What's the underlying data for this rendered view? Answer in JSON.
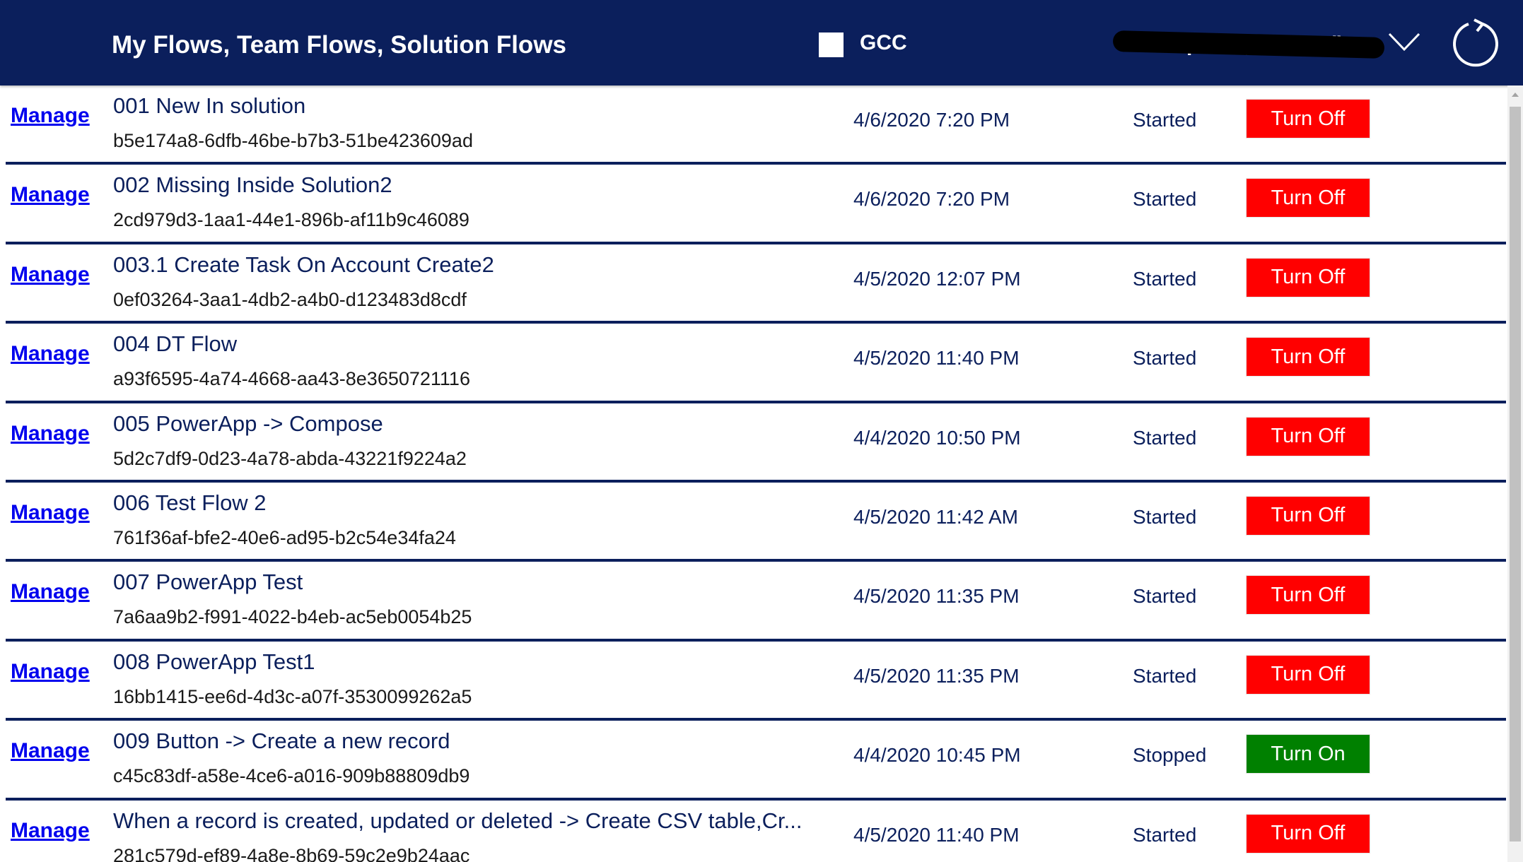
{
  "header": {
    "title": "My Flows, Team Flows, Solution Flows",
    "gcc_label": "GCC",
    "gcc_checked": false,
    "environment_label": "Lookup Inc (redacted)",
    "environment_redacted": true,
    "chevron_icon": "chevron-down-icon",
    "refresh_icon": "refresh-icon",
    "background_color": "#0b1f5c"
  },
  "colors": {
    "turn_off": "#ff0000",
    "turn_on": "#008000",
    "link": "#0000ee",
    "text": "#0b1f5c"
  },
  "flows": [
    {
      "manage_label": "Manage",
      "name": "001 New In solution",
      "id": "b5e174a8-6dfb-46be-b7b3-51be423609ad",
      "modified": "4/6/2020 7:20 PM",
      "status": "Started",
      "action_label": "Turn Off",
      "action_color": "#ff0000"
    },
    {
      "manage_label": "Manage",
      "name": "002 Missing Inside Solution2",
      "id": "2cd979d3-1aa1-44e1-896b-af11b9c46089",
      "modified": "4/6/2020 7:20 PM",
      "status": "Started",
      "action_label": "Turn Off",
      "action_color": "#ff0000"
    },
    {
      "manage_label": "Manage",
      "name": "003.1 Create Task On Account Create2",
      "id": "0ef03264-3aa1-4db2-a4b0-d123483d8cdf",
      "modified": "4/5/2020 12:07 PM",
      "status": "Started",
      "action_label": "Turn Off",
      "action_color": "#ff0000"
    },
    {
      "manage_label": "Manage",
      "name": "004 DT Flow",
      "id": "a93f6595-4a74-4668-aa43-8e3650721116",
      "modified": "4/5/2020 11:40 PM",
      "status": "Started",
      "action_label": "Turn Off",
      "action_color": "#ff0000"
    },
    {
      "manage_label": "Manage",
      "name": "005 PowerApp -> Compose",
      "id": "5d2c7df9-0d23-4a78-abda-43221f9224a2",
      "modified": "4/4/2020 10:50 PM",
      "status": "Started",
      "action_label": "Turn Off",
      "action_color": "#ff0000"
    },
    {
      "manage_label": "Manage",
      "name": "006 Test Flow 2",
      "id": "761f36af-bfe2-40e6-ad95-b2c54e34fa24",
      "modified": "4/5/2020 11:42 AM",
      "status": "Started",
      "action_label": "Turn Off",
      "action_color": "#ff0000"
    },
    {
      "manage_label": "Manage",
      "name": "007 PowerApp Test",
      "id": "7a6aa9b2-f991-4022-b4eb-ac5eb0054b25",
      "modified": "4/5/2020 11:35 PM",
      "status": "Started",
      "action_label": "Turn Off",
      "action_color": "#ff0000"
    },
    {
      "manage_label": "Manage",
      "name": "008 PowerApp Test1",
      "id": "16bb1415-ee6d-4d3c-a07f-3530099262a5",
      "modified": "4/5/2020 11:35 PM",
      "status": "Started",
      "action_label": "Turn Off",
      "action_color": "#ff0000"
    },
    {
      "manage_label": "Manage",
      "name": "009 Button -> Create a new record",
      "id": "c45c83df-a58e-4ce6-a016-909b88809db9",
      "modified": "4/4/2020 10:45 PM",
      "status": "Stopped",
      "action_label": "Turn On",
      "action_color": "#008000"
    },
    {
      "manage_label": "Manage",
      "name": "When a record is created, updated or deleted -> Create CSV table,Cr...",
      "id": "281c579d-ef89-4a8e-8b69-59c2e9b24aac",
      "modified": "4/5/2020 11:40 PM",
      "status": "Started",
      "action_label": "Turn Off",
      "action_color": "#ff0000"
    }
  ]
}
